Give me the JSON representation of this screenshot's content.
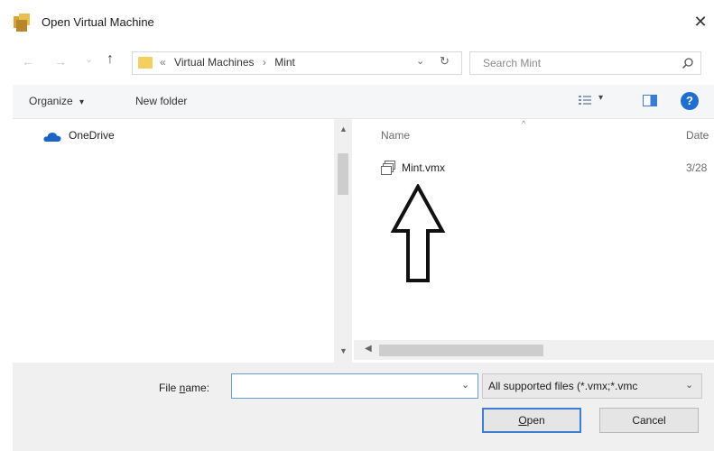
{
  "window": {
    "title": "Open Virtual Machine",
    "close_symbol": "✕"
  },
  "nav": {
    "back_symbol": "←",
    "forward_symbol": "→",
    "recent_symbol": "⌄",
    "up_symbol": "↑",
    "address": {
      "prefix": "«",
      "parts": [
        "Virtual Machines",
        "Mint"
      ],
      "separator": "›",
      "dropdown_symbol": "⌄",
      "refresh_symbol": "↻"
    },
    "search": {
      "placeholder": "Search Mint",
      "icon": "search-icon"
    }
  },
  "toolbar": {
    "organize_label": "Organize",
    "organize_caret": "▾",
    "new_folder_label": "New folder",
    "view_caret": "▾",
    "help_symbol": "?"
  },
  "nav_pane": {
    "items": [
      {
        "label": "OneDrive",
        "icon": "cloud-icon"
      }
    ]
  },
  "file_list": {
    "columns": [
      "Name",
      "Date"
    ],
    "sort_indicator": "^",
    "files": [
      {
        "name": "Mint.vmx",
        "date": "3/28",
        "icon": "vm-file-icon"
      }
    ]
  },
  "scrollbars": {
    "up": "▲",
    "down": "▼",
    "left": "◀",
    "right": "▶"
  },
  "bottom": {
    "filename_label_pre": "File ",
    "filename_label_ul": "n",
    "filename_label_post": "ame:",
    "filename_value": "",
    "filename_dropdown": "⌄",
    "filter_label": "All supported files (*.vmx;*.vmc",
    "filter_dropdown": "⌄",
    "open_label_ul": "O",
    "open_label_rest": "pen",
    "cancel_label": "Cancel"
  },
  "colors": {
    "accent": "#1f6fd1",
    "folder": "#f3cf62",
    "toolbar_bg": "#f5f6f7",
    "bottom_bg": "#f0f0f0"
  }
}
